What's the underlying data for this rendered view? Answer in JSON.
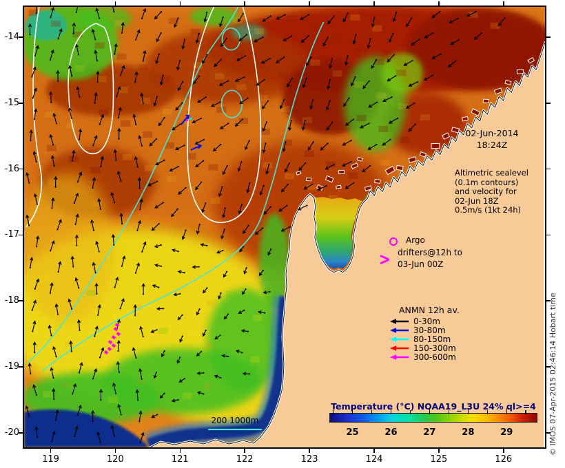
{
  "map": {
    "datetime": {
      "line1": "02-Jun-2014",
      "line2": "18:24Z"
    },
    "altimetric_note": {
      "lines": [
        "Altimetric sealevel",
        "(0.1m contours)",
        "and velocity for",
        "02-Jun 18Z",
        "0.5m/s (1kt 24h)"
      ]
    },
    "argo": {
      "label": "Argo",
      "color": "#FF00FF"
    },
    "drifters": {
      "line1": "drifters@12h to",
      "line2": "03-Jun 00Z",
      "chevron": ">",
      "color": "#FF00FF"
    },
    "anmn": {
      "title": "ANMN 12h av.",
      "items": [
        {
          "label": "0-30m",
          "color": "#000000"
        },
        {
          "label": "30-80m",
          "color": "#0000DD"
        },
        {
          "label": "80-150m",
          "color": "#00FFFF"
        },
        {
          "label": "150-300m",
          "color": "#FF0000"
        },
        {
          "label": "300-600m",
          "color": "#FF00FF"
        }
      ]
    },
    "isobaths": {
      "label": "200 1000m",
      "line_color": "#45E8D5"
    },
    "copyright": "© IMOS 07-Apr-2015 02:46:14 Hobart time"
  },
  "colorbar": {
    "title": "Temperature (°C) NOAA19_L3U 24% ql>=4",
    "title_color": "#00007D",
    "tick_labels": [
      "25",
      "26",
      "27",
      "28",
      "29"
    ],
    "value_min": 24.4,
    "value_max": 29.8,
    "gradient_stops": [
      [
        0,
        "#0D0D7E"
      ],
      [
        0.08,
        "#1830C8"
      ],
      [
        0.16,
        "#1058EC"
      ],
      [
        0.24,
        "#00A2F5"
      ],
      [
        0.3,
        "#00D2DE"
      ],
      [
        0.38,
        "#00E2A6"
      ],
      [
        0.46,
        "#2AC84A"
      ],
      [
        0.52,
        "#52C818"
      ],
      [
        0.6,
        "#A2D800"
      ],
      [
        0.68,
        "#F0E000"
      ],
      [
        0.75,
        "#FFC000"
      ],
      [
        0.82,
        "#FF8800"
      ],
      [
        0.88,
        "#EE5300"
      ],
      [
        0.93,
        "#CB2100"
      ],
      [
        1,
        "#8C0A00"
      ]
    ]
  },
  "axes": {
    "lon_tick_labels": [
      "119",
      "120",
      "121",
      "122",
      "123",
      "124",
      "125",
      "126"
    ],
    "lat_tick_labels": [
      "-14",
      "-15",
      "-16",
      "-17",
      "-18",
      "-19",
      "-20"
    ]
  }
}
